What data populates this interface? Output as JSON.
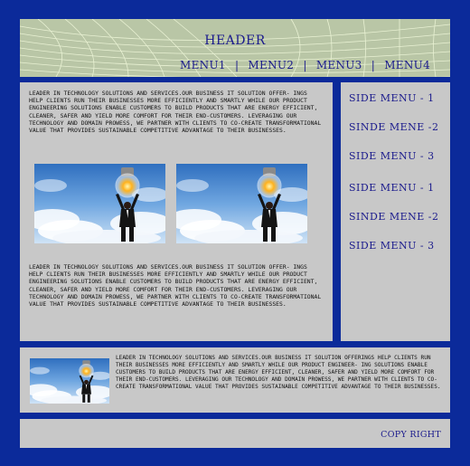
{
  "header": {
    "title": "HEADER",
    "menu": [
      "MENU1",
      "MENU2",
      "MENU3",
      "MENU4"
    ],
    "separator": "|"
  },
  "main": {
    "paragraph_1": "LEADER IN TECHNOLOGY SOLUTIONS AND SERVICES.OUR BUSINESS IT SOLUTION OFFER- INGS HELP CLIENTS RUN THEIR BUSINESSES MORE EFFICIENTLY AND SMARTLY WHILE OUR PRODUCT ENGINEERING SOLUTIONS ENABLE CUSTOMERS TO BUILD PRODUCTS THAT ARE ENERGY EFFICIENT, CLEANER, SAFER AND YIELD MORE COMFORT FOR THEIR END-CUSTOMERS. LEVERAGING OUR TECHNOLOGY AND DOMAIN PROWESS, WE PARTNER WITH CLIENTS TO CO-CREATE TRANSFORMATIONAL VALUE THAT PROVIDES SUSTAINABLE COMPETITIVE ADVANTAGE TO THEIR BUSINESSES.",
    "paragraph_2": "LEADER IN TECHNOLOGY SOLUTIONS AND SERVICES.OUR BUSINESS IT SOLUTION OFFER- INGS HELP CLIENTS RUN THEIR BUSINESSES MORE EFFICIENTLY AND SMARTLY WHILE OUR PRODUCT ENGINEERING SOLUTIONS ENABLE CUSTOMERS TO BUILD PRODUCTS THAT ARE ENERGY EFFICIENT, CLEANER, SAFER AND YIELD MORE COMFORT FOR THEIR END-CUSTOMERS. LEVERAGING OUR TECHNOLOGY AND DOMAIN PROWESS, WE PARTNER WITH CLIENTS TO CO-CREATE TRANSFORMATIONAL VALUE THAT PROVIDES SUSTAINABLE COMPETITIVE ADVANTAGE TO THEIR BUSINESSES."
  },
  "side_menu": {
    "items": [
      "SIDE MENU - 1",
      "SINDE MENE -2",
      "SIDE MENU - 3",
      "SIDE MENU - 1",
      "SINDE MENE -2",
      "SIDE MENU - 3"
    ]
  },
  "lower": {
    "paragraph": "LEADER IN TECHNOLOGY SOLUTIONS AND SERVICES.OUR BUSINESS IT SOLUTION OFFERINGS HELP CLIENTS RUN THEIR BUSINESSES MORE EFFICIENTLY AND SMARTLY WHILE OUR PRODUCT ENGINEER- ING SOLUTIONS ENABLE CUSTOMERS TO BUILD PRODUCTS THAT ARE ENERGY EFFICIENT, CLEANER, SAFER AND YIELD MORE COMFORT FOR THEIR END-CUSTOMERS. LEVERAGING OUR TECHNOLOGY AND DOMAIN PROWESS, WE PARTNER WITH CLIENTS TO CO-CREATE TRANSFORMATIONAL VALUE THAT PROVIDES SUSTAINABLE COMPETITIVE ADVANTAGE TO THEIR BUSINESSES."
  },
  "footer": {
    "copyright": "COPY RIGHT"
  },
  "colors": {
    "page_background": "#0b2a9a",
    "panel": "#c8c8c8",
    "header_background": "#b7c4a4",
    "link_text": "#1a1a8c"
  },
  "icons": [
    "lightbulb-businessman-image"
  ]
}
